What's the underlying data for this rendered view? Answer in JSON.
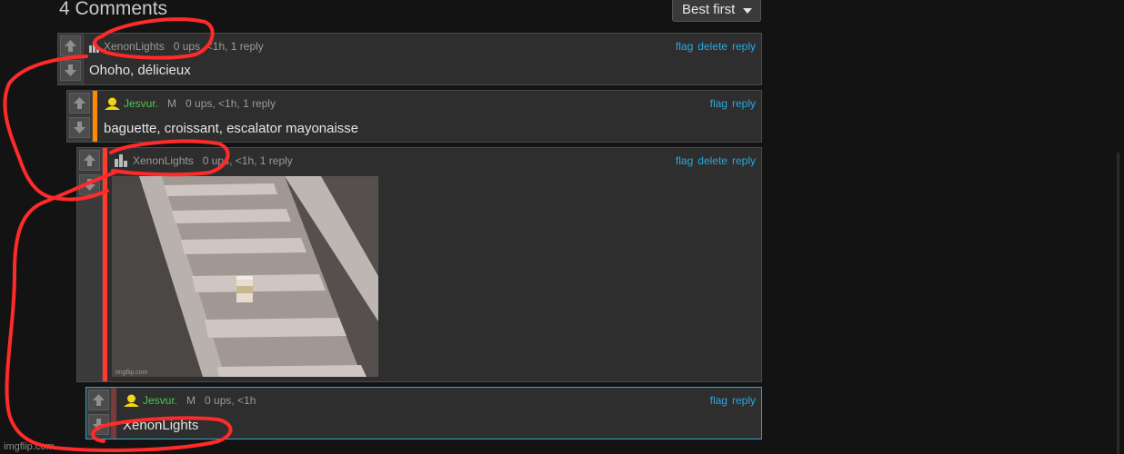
{
  "header": {
    "comment_count_title": "4 Comments",
    "sort_label": "Best first"
  },
  "comments": [
    {
      "username": "XenonLights",
      "meta": "0 ups, <1h, 1 reply",
      "text": "Ohoho, délicieux",
      "actions": [
        "flag",
        "delete",
        "reply"
      ],
      "avatar": "imgflip-logo-icon"
    },
    {
      "username": "Jesvur.",
      "role": "M",
      "meta": "0 ups, <1h, 1 reply",
      "text": "baguette, croissant, escalator mayonaisse",
      "actions": [
        "flag",
        "reply"
      ],
      "avatar": "user-icon-yellow",
      "stripe_color": "#ff8a00"
    },
    {
      "username": "XenonLights",
      "meta": "0 ups, <1h, 1 reply",
      "image_watermark": "imgflip.com",
      "actions": [
        "flag",
        "delete",
        "reply"
      ],
      "avatar": "imgflip-logo-icon",
      "stripe_color": "#ff3b30"
    },
    {
      "username": "Jesvur.",
      "role": "M",
      "meta": "0 ups, <1h",
      "text": "XenonLights",
      "actions": [
        "flag",
        "reply"
      ],
      "avatar": "user-icon-yellow",
      "stripe_color": "#7a3b3b"
    }
  ],
  "footer": {
    "watermark": "imgflip.com"
  },
  "colors": {
    "link": "#2aa7e0",
    "mod_user": "#4cc84c",
    "annotation": "#ff2a2a"
  }
}
